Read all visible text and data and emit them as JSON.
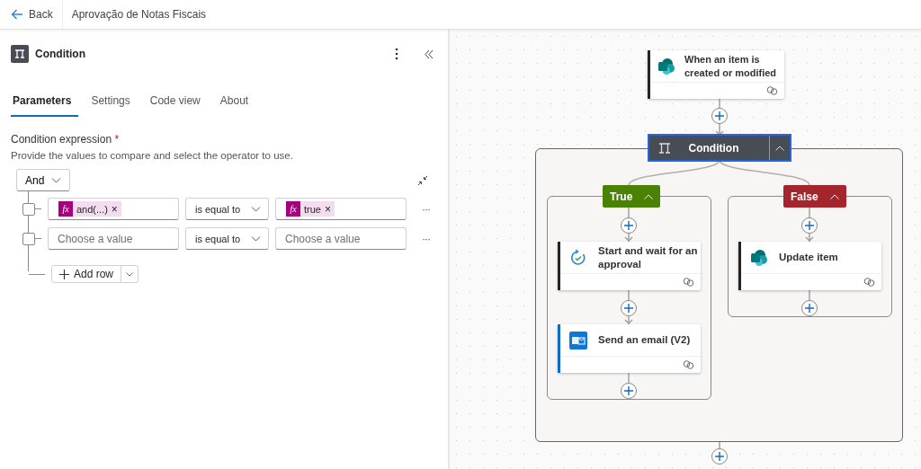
{
  "header": {
    "back": "Back",
    "title": "Aprovação de Notas Fiscais"
  },
  "panel": {
    "title": "Condition",
    "tabs": [
      {
        "label": "Parameters",
        "selected": true
      },
      {
        "label": "Settings",
        "selected": false
      },
      {
        "label": "Code view",
        "selected": false
      },
      {
        "label": "About",
        "selected": false
      }
    ],
    "field_label": "Condition expression",
    "required_mark": "*",
    "description": "Provide the values to compare and select the operator to use.",
    "group_operator": "And",
    "rows": [
      {
        "checked": false,
        "left": {
          "kind": "token",
          "icon": "fx",
          "text": "and(...)",
          "remove": "×"
        },
        "operator": "is equal to",
        "right": {
          "kind": "token",
          "icon": "fx",
          "text": "true",
          "remove": "×"
        },
        "more": "···"
      },
      {
        "checked": false,
        "left": {
          "kind": "input",
          "placeholder": "Choose a value"
        },
        "operator": "is equal to",
        "right": {
          "kind": "input",
          "placeholder": "Choose a value"
        },
        "more": "···"
      }
    ],
    "add_row": "Add row"
  },
  "canvas": {
    "trigger": {
      "title": "When an item is created or modified",
      "kind": "sharepoint",
      "color": "#242424"
    },
    "condition": {
      "title": "Condition",
      "selected": true,
      "expanded": true
    },
    "branches": [
      {
        "label": "True",
        "color": "#498205",
        "expanded": true,
        "actions": [
          {
            "title": "Start and wait for an approval",
            "kind": "approval",
            "color": "#242424"
          },
          {
            "title": "Send an email (V2)",
            "kind": "outlook",
            "color": "#0f6cbd"
          }
        ]
      },
      {
        "label": "False",
        "color": "#a4262c",
        "expanded": true,
        "actions": [
          {
            "title": "Update item",
            "kind": "sharepoint",
            "color": "#242424"
          }
        ]
      }
    ]
  }
}
